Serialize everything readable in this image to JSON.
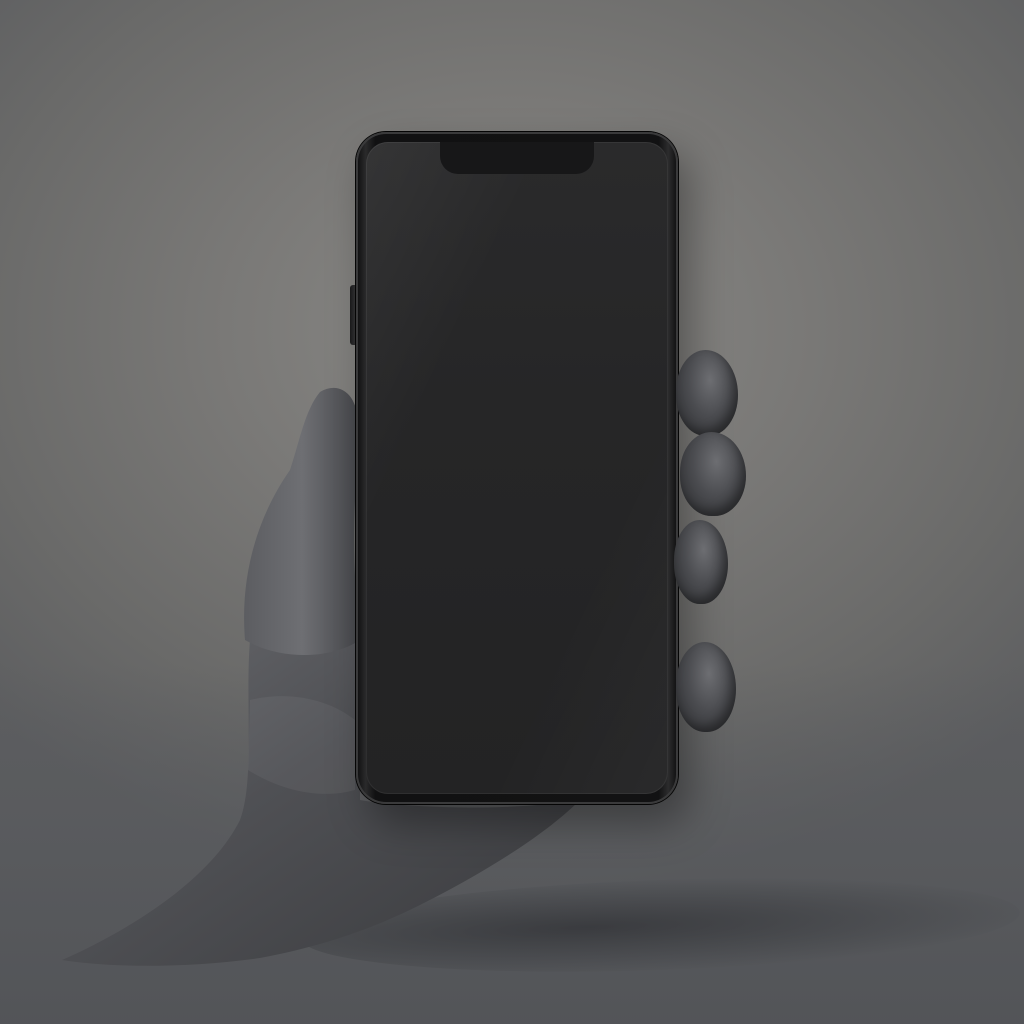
{
  "scene": {
    "description_colors": {
      "background": "#7a7977",
      "hand": "#48494d",
      "phone_frame": "#121213",
      "screen": "#262627"
    },
    "icons": [
      "hand-icon",
      "smartphone-icon"
    ]
  }
}
